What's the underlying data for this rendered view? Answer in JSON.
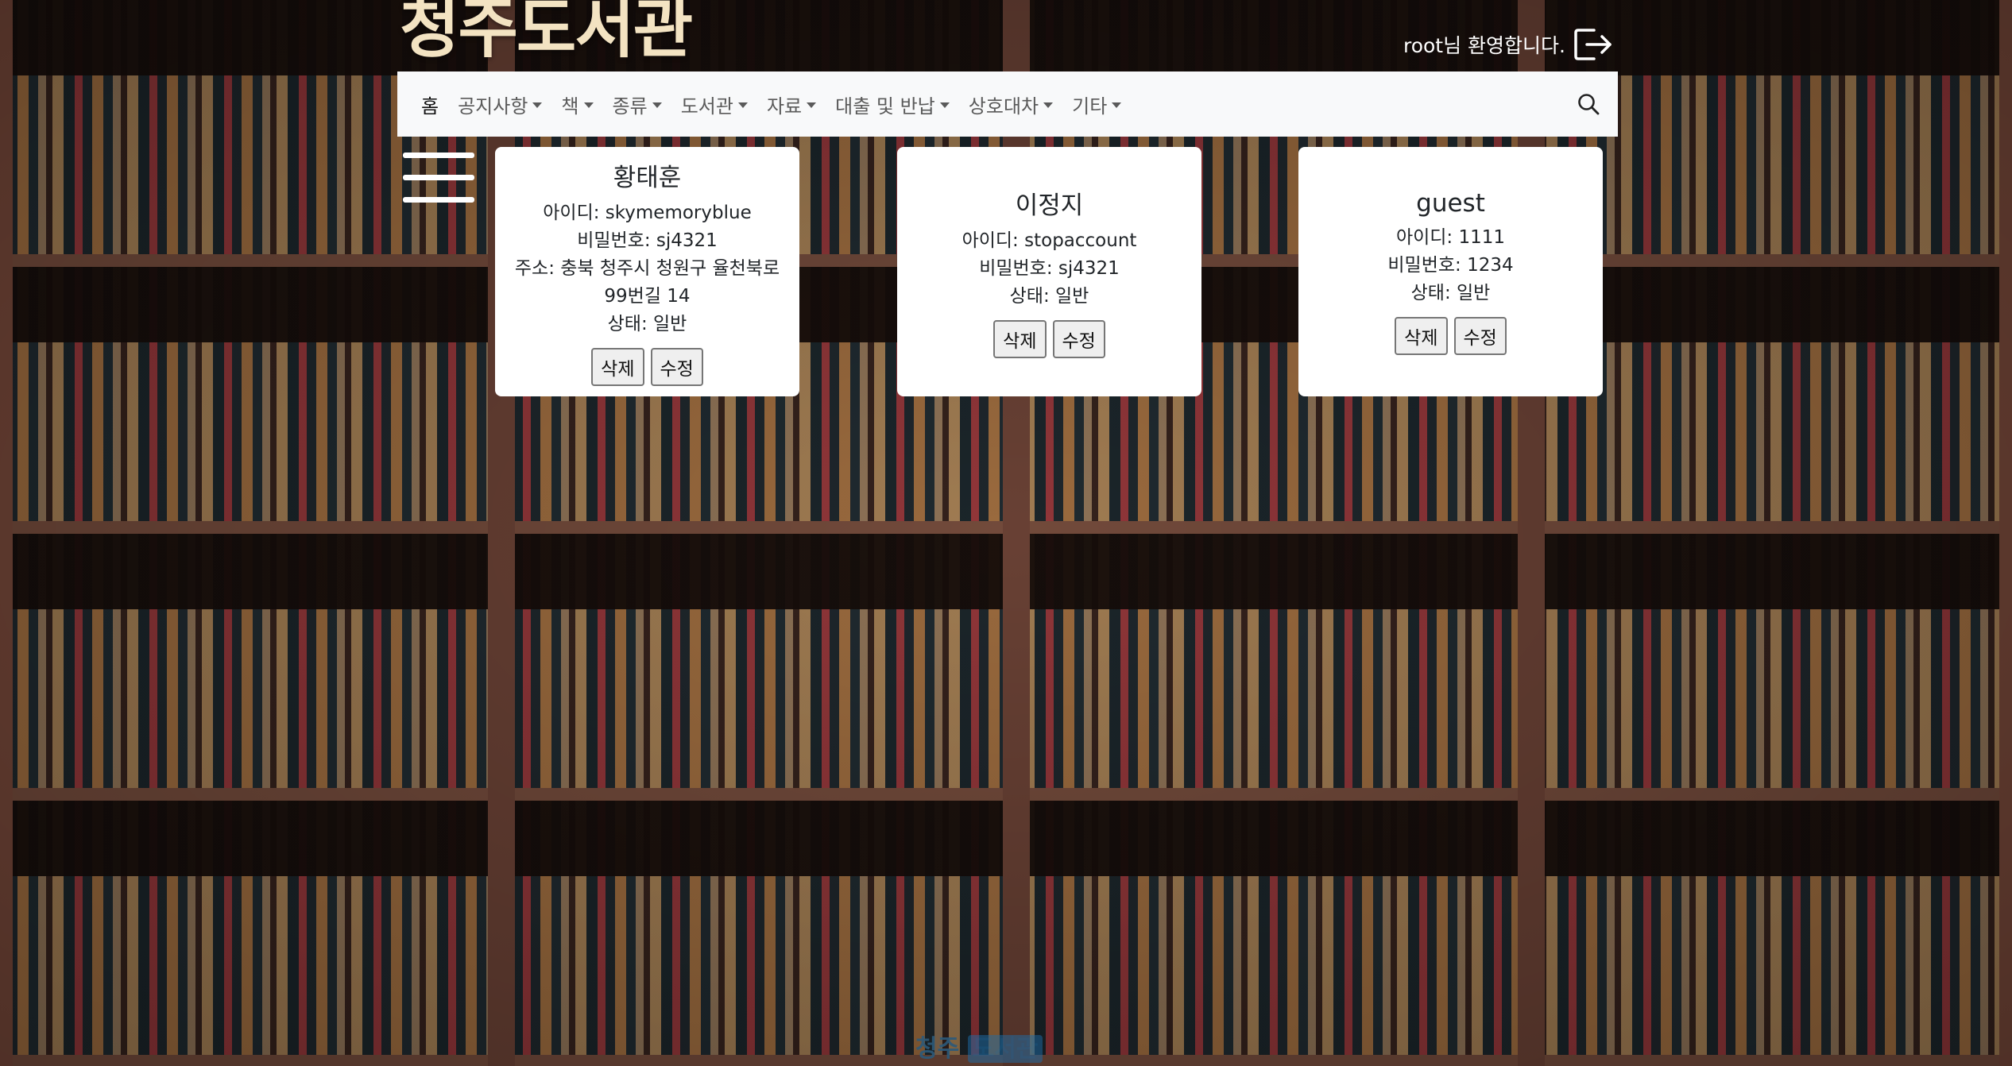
{
  "site": {
    "title": "청주도서관"
  },
  "header": {
    "welcome_text": "root님 환영합니다.",
    "logout_icon": "logout-icon"
  },
  "nav": {
    "items": [
      {
        "label": "홈",
        "active": true,
        "dropdown": false
      },
      {
        "label": "공지사항",
        "dropdown": true
      },
      {
        "label": "책",
        "dropdown": true
      },
      {
        "label": "종류",
        "dropdown": true
      },
      {
        "label": "도서관",
        "dropdown": true
      },
      {
        "label": "자료",
        "dropdown": true
      },
      {
        "label": "대출 및 반납",
        "dropdown": true
      },
      {
        "label": "상호대차",
        "dropdown": true
      },
      {
        "label": "기타",
        "dropdown": true
      }
    ],
    "search_icon": "search-icon"
  },
  "menu_icon": "hamburger-menu-icon",
  "users": [
    {
      "name": "황태훈",
      "id_line": "아이디: skymemoryblue",
      "pw_line": "비밀번호: sj4321",
      "addr_line": "주소: 충북 청주시 청원구 율천북로99번길 14",
      "status_line": "상태: 일반",
      "delete_label": "삭제",
      "edit_label": "수정"
    },
    {
      "name": "이정지",
      "id_line": "아이디: stopaccount",
      "pw_line": "비밀번호: sj4321",
      "status_line": "상태: 일반",
      "delete_label": "삭제",
      "edit_label": "수정"
    },
    {
      "name": "guest",
      "id_line": "아이디: 1111",
      "pw_line": "비밀번호: 1234",
      "status_line": "상태: 일반",
      "delete_label": "삭제",
      "edit_label": "수정"
    }
  ],
  "footer": {
    "text_a": "청주",
    "text_b": "도서관"
  },
  "colors": {
    "title": "#f3e3c2",
    "navbar_bg": "#f8f9fa",
    "card_bg": "#ffffff",
    "footer_text": "#2c5a7a"
  }
}
